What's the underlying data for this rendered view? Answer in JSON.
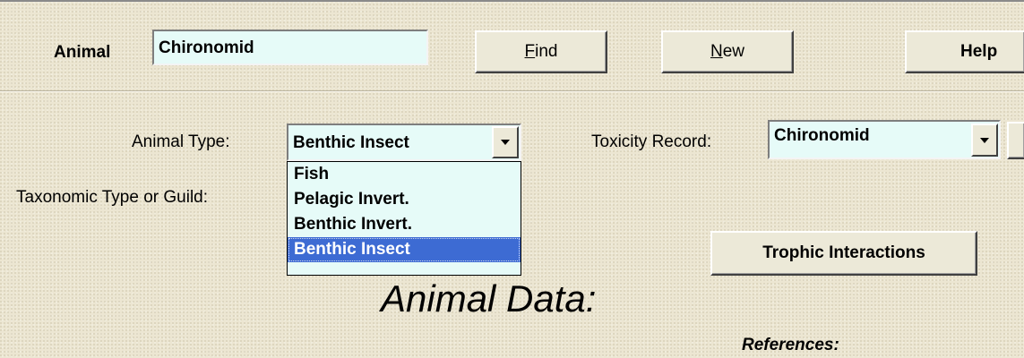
{
  "header": {
    "animal_label": "Animal",
    "animal_value": "Chironomid",
    "find_prefix": "F",
    "find_rest": "ind",
    "new_prefix": "N",
    "new_rest": "ew",
    "help_label": "Help"
  },
  "form": {
    "animal_type_label": "Animal Type:",
    "animal_type_value": "Benthic Insect",
    "toxicity_label": "Toxicity Record:",
    "toxicity_value": "Chironomid",
    "taxonomic_label": "Taxonomic Type or Guild:"
  },
  "dropdown": {
    "options": [
      "Fish",
      "Pelagic Invert.",
      "Benthic Invert.",
      "Benthic Insect"
    ],
    "selected_index": 3
  },
  "buttons": {
    "trophic": "Trophic Interactions"
  },
  "section": {
    "title": "Animal Data:",
    "references_label": "References:"
  }
}
